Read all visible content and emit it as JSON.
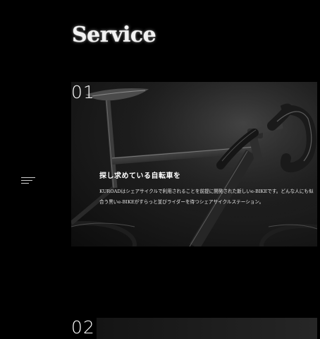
{
  "section": {
    "title": "Service"
  },
  "menu": {
    "icon": "menu-lines-icon"
  },
  "services": [
    {
      "number": "01",
      "image": "bicycle-photo",
      "heading": "探し求めている自転車を",
      "text": "KUROADはシェアサイクルで利用されることを前提に開発された新しいe-BIKEです。どんな人にも似合う黒いe-BIKEがすらっと並びライダーを待つシェアサイクルステーション。"
    },
    {
      "number": "02"
    }
  ]
}
